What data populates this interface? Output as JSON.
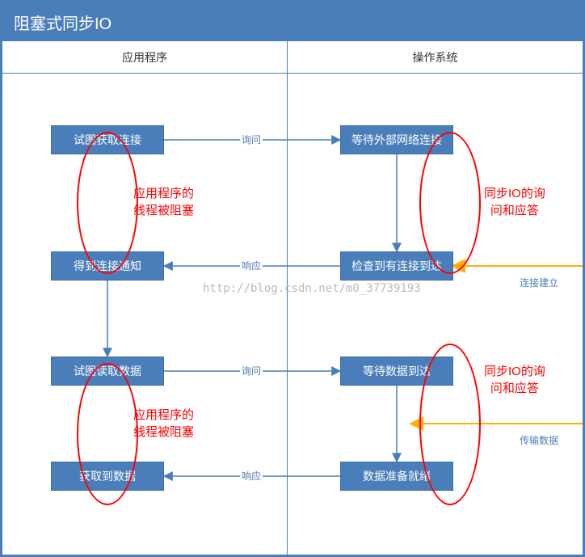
{
  "title": "阻塞式同步IO",
  "columns": {
    "left": "应用程序",
    "right": "操作系统"
  },
  "nodes": {
    "a1": "试图获取连接",
    "a2": "得到连接通知",
    "a3": "试图读取数据",
    "a4": "获取到数据",
    "b1": "等待外部网络连接",
    "b2": "检查到有连接到达",
    "b3": "等待数据到达",
    "b4": "数据准备就绪"
  },
  "edgeLabels": {
    "ask1": "询问",
    "resp1": "响应",
    "ask2": "询问",
    "resp2": "响应"
  },
  "annotations": {
    "blk1": "应用程序的\n线程被阻塞",
    "blk2": "应用程序的\n线程被阻塞",
    "sync1": "同步IO的询\n问和应答",
    "sync2": "同步IO的询\n问和应答"
  },
  "external": {
    "conn": "连接建立",
    "data": "传输数据"
  },
  "watermark": "http://blog.csdn.net/m0_37739193",
  "chart_data": {
    "type": "flowchart",
    "title": "阻塞式同步IO",
    "swimlanes": [
      "应用程序",
      "操作系统"
    ],
    "nodes": [
      {
        "id": "a1",
        "lane": "应用程序",
        "label": "试图获取连接"
      },
      {
        "id": "a2",
        "lane": "应用程序",
        "label": "得到连接通知"
      },
      {
        "id": "a3",
        "lane": "应用程序",
        "label": "试图读取数据"
      },
      {
        "id": "a4",
        "lane": "应用程序",
        "label": "获取到数据"
      },
      {
        "id": "b1",
        "lane": "操作系统",
        "label": "等待外部网络连接"
      },
      {
        "id": "b2",
        "lane": "操作系统",
        "label": "检查到有连接到达"
      },
      {
        "id": "b3",
        "lane": "操作系统",
        "label": "等待数据到达"
      },
      {
        "id": "b4",
        "lane": "操作系统",
        "label": "数据准备就绪"
      }
    ],
    "edges": [
      {
        "from": "a1",
        "to": "b1",
        "label": "询问"
      },
      {
        "from": "b1",
        "to": "b2"
      },
      {
        "from": "b2",
        "to": "a2",
        "label": "响应"
      },
      {
        "from": "a2",
        "to": "a3"
      },
      {
        "from": "a3",
        "to": "b3",
        "label": "询问"
      },
      {
        "from": "b3",
        "to": "b4"
      },
      {
        "from": "b4",
        "to": "a4",
        "label": "响应"
      },
      {
        "from": "external",
        "to": "b2",
        "label": "连接建立"
      },
      {
        "from": "external",
        "to": "b3-b4",
        "label": "传输数据"
      }
    ],
    "annotations": [
      {
        "targets": [
          "a1",
          "a2"
        ],
        "text": "应用程序的线程被阻塞"
      },
      {
        "targets": [
          "b1",
          "b2"
        ],
        "text": "同步IO的询问和应答"
      },
      {
        "targets": [
          "a3",
          "a4"
        ],
        "text": "应用程序的线程被阻塞"
      },
      {
        "targets": [
          "b3",
          "b4"
        ],
        "text": "同步IO的询问和应答"
      }
    ]
  }
}
